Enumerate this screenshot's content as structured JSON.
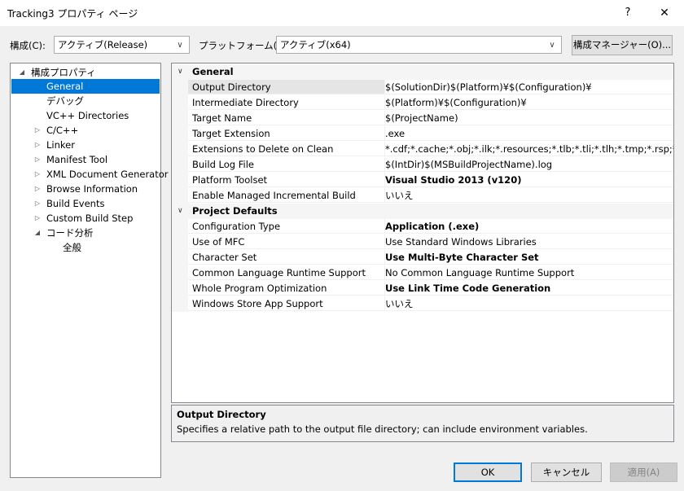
{
  "window": {
    "title": "Tracking3 プロパティ ページ",
    "help_glyph": "?",
    "close_glyph": "✕"
  },
  "config": {
    "config_label": "構成(C):",
    "config_value": "アクティブ(Release)",
    "platform_label": "プラットフォーム(P):",
    "platform_value": "アクティブ(x64)",
    "manager_button": "構成マネージャー(O)..."
  },
  "tree": {
    "items": [
      {
        "label": "構成プロパティ",
        "expander": "◢"
      },
      {
        "label": "General",
        "expander": ""
      },
      {
        "label": "デバッグ",
        "expander": ""
      },
      {
        "label": "VC++ Directories",
        "expander": ""
      },
      {
        "label": "C/C++",
        "expander": "▷"
      },
      {
        "label": "Linker",
        "expander": "▷"
      },
      {
        "label": "Manifest Tool",
        "expander": "▷"
      },
      {
        "label": "XML Document Generator",
        "expander": "▷"
      },
      {
        "label": "Browse Information",
        "expander": "▷"
      },
      {
        "label": "Build Events",
        "expander": "▷"
      },
      {
        "label": "Custom Build Step",
        "expander": "▷"
      },
      {
        "label": "コード分析",
        "expander": "◢"
      },
      {
        "label": "全般",
        "expander": ""
      }
    ]
  },
  "grid": {
    "categories": [
      {
        "title": "General",
        "chevron": "∨"
      },
      {
        "title": "Project Defaults",
        "chevron": "∨"
      }
    ],
    "general": [
      {
        "name": "Output Directory",
        "value": "$(SolutionDir)$(Platform)¥$(Configuration)¥"
      },
      {
        "name": "Intermediate Directory",
        "value": "$(Platform)¥$(Configuration)¥"
      },
      {
        "name": "Target Name",
        "value": "$(ProjectName)"
      },
      {
        "name": "Target Extension",
        "value": ".exe"
      },
      {
        "name": "Extensions to Delete on Clean",
        "value": "*.cdf;*.cache;*.obj;*.ilk;*.resources;*.tlb;*.tli;*.tlh;*.tmp;*.rsp;*.pgc;*.p"
      },
      {
        "name": "Build Log File",
        "value": "$(IntDir)$(MSBuildProjectName).log"
      },
      {
        "name": "Platform Toolset",
        "value": "Visual Studio 2013 (v120)"
      },
      {
        "name": "Enable Managed Incremental Build",
        "value": "いいえ"
      }
    ],
    "defaults": [
      {
        "name": "Configuration Type",
        "value": "Application (.exe)"
      },
      {
        "name": "Use of MFC",
        "value": "Use Standard Windows Libraries"
      },
      {
        "name": "Character Set",
        "value": "Use Multi-Byte Character Set"
      },
      {
        "name": "Common Language Runtime Support",
        "value": "No Common Language Runtime Support"
      },
      {
        "name": "Whole Program Optimization",
        "value": "Use Link Time Code Generation"
      },
      {
        "name": "Windows Store App Support",
        "value": "いいえ"
      }
    ]
  },
  "description": {
    "title": "Output Directory",
    "text": "Specifies a relative path to the output file directory; can include environment variables."
  },
  "buttons": {
    "ok": "OK",
    "cancel": "キャンセル",
    "apply": "適用(A)"
  },
  "colors": {
    "selection": "#0078d7",
    "background": "#f0f0f0"
  }
}
